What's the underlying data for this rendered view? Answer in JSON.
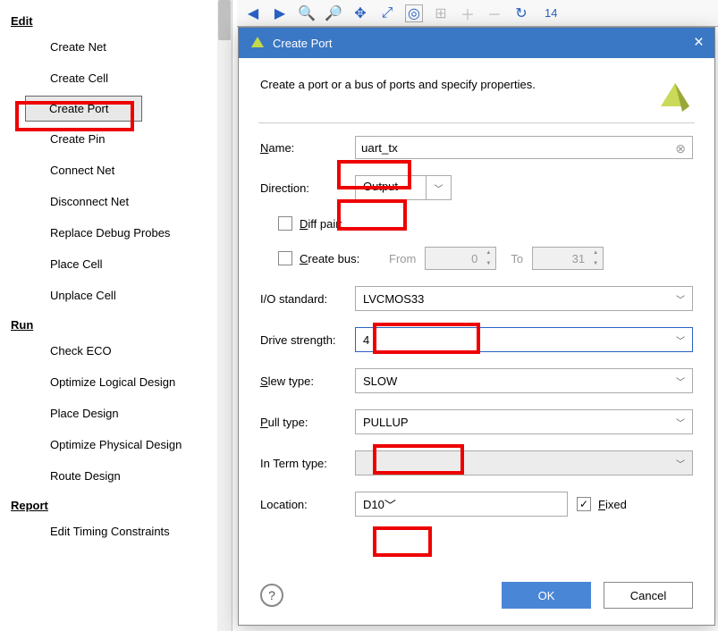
{
  "sidebar": {
    "sections": [
      {
        "title": "Edit",
        "items": [
          "Create Net",
          "Create Cell",
          "Create Port",
          "Create Pin",
          "Connect Net",
          "Disconnect Net",
          "Replace Debug Probes",
          "Place Cell",
          "Unplace Cell"
        ]
      },
      {
        "title": "Run",
        "items": [
          "Check ECO",
          "Optimize Logical Design",
          "Place Design",
          "Optimize Physical Design",
          "Route Design"
        ]
      },
      {
        "title": "Report",
        "items": [
          "Edit Timing Constraints"
        ]
      }
    ],
    "selected": "Create Port"
  },
  "toolbar": {
    "right_text": "14"
  },
  "dialog": {
    "title": "Create Port",
    "description": "Create a port or a bus of ports and specify properties.",
    "name": {
      "label": "Name:",
      "value": "uart_tx"
    },
    "direction": {
      "label": "Direction:",
      "value": "Output"
    },
    "diff_pair": {
      "label": "Diff pair:",
      "checked": false
    },
    "create_bus": {
      "label": "Create bus:",
      "checked": false,
      "from_label": "From",
      "from_value": "0",
      "to_label": "To",
      "to_value": "31"
    },
    "io_standard": {
      "label": "I/O standard:",
      "value": "LVCMOS33"
    },
    "drive_strength": {
      "label": "Drive strength:",
      "value": "4"
    },
    "slew_type": {
      "label": "Slew type:",
      "value": "SLOW"
    },
    "pull_type": {
      "label": "Pull type:",
      "value": "PULLUP"
    },
    "in_term_type": {
      "label": "In Term type:",
      "value": ""
    },
    "location": {
      "label": "Location:",
      "value": "D10",
      "fixed_label": "Fixed",
      "fixed_checked": true
    },
    "buttons": {
      "ok": "OK",
      "cancel": "Cancel",
      "help": "?"
    },
    "close": "×"
  }
}
